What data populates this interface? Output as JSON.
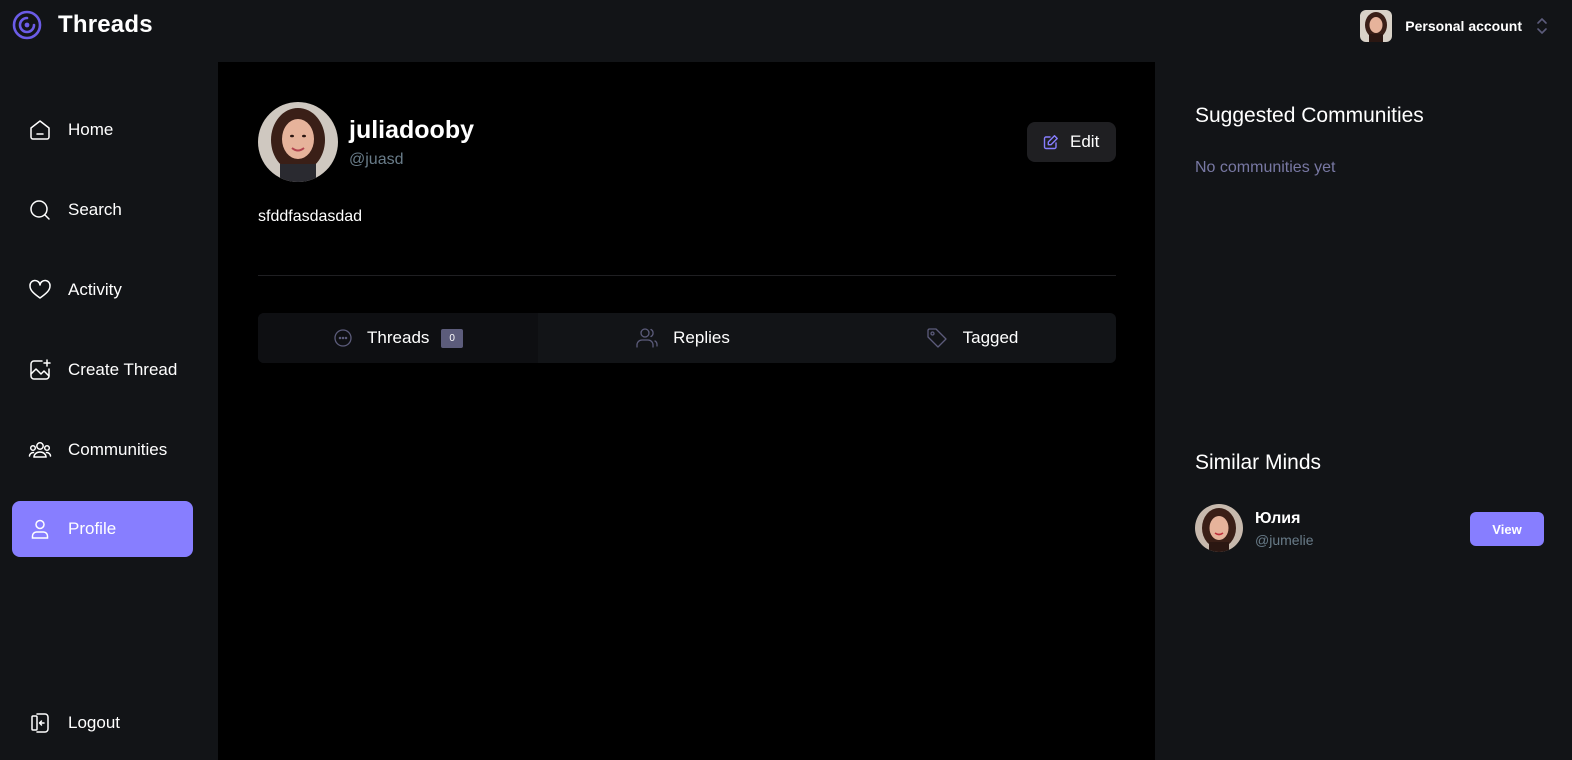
{
  "app": {
    "title": "Threads"
  },
  "account": {
    "label": "Personal account"
  },
  "nav": {
    "items": [
      {
        "label": "Home",
        "icon": "home-icon"
      },
      {
        "label": "Search",
        "icon": "search-icon"
      },
      {
        "label": "Activity",
        "icon": "heart-icon"
      },
      {
        "label": "Create Thread",
        "icon": "create-thread-icon"
      },
      {
        "label": "Communities",
        "icon": "communities-icon"
      },
      {
        "label": "Profile",
        "icon": "user-icon",
        "active": true
      }
    ],
    "logout": {
      "label": "Logout",
      "icon": "logout-icon"
    }
  },
  "profile": {
    "name": "juliadooby",
    "handle": "@juasd",
    "bio": "sfddfasdasdad",
    "edit_label": "Edit"
  },
  "tabs": [
    {
      "label": "Threads",
      "icon": "chat-bubble-icon",
      "count": "0",
      "active": true
    },
    {
      "label": "Replies",
      "icon": "members-icon"
    },
    {
      "label": "Tagged",
      "icon": "tag-icon"
    }
  ],
  "right": {
    "suggested": {
      "title": "Suggested Communities",
      "empty": "No communities yet"
    },
    "similar": {
      "title": "Similar Minds",
      "users": [
        {
          "name": "Юлия",
          "handle": "@jumelie",
          "button": "View"
        }
      ]
    }
  },
  "colors": {
    "accent": "#877eff",
    "background": "#000000",
    "panel": "#121417",
    "muted": "#697c89",
    "muted_purple": "#7878a3"
  }
}
